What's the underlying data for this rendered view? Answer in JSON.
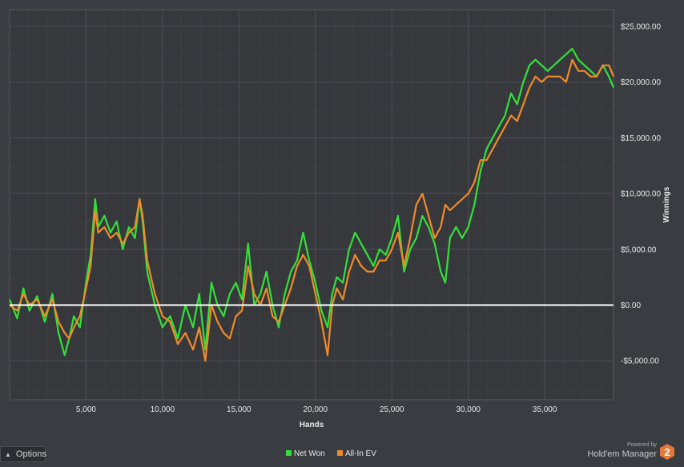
{
  "chart_data": {
    "type": "line",
    "xlabel": "Hands",
    "ylabel": "Winnings",
    "xlim": [
      0,
      39500
    ],
    "ylim": [
      -8500,
      26500
    ],
    "x_ticks": [
      5000,
      10000,
      15000,
      20000,
      25000,
      30000,
      35000
    ],
    "x_tick_labels": [
      "5,000",
      "10,000",
      "15,000",
      "20,000",
      "25,000",
      "30,000",
      "35,000"
    ],
    "y_ticks": [
      -5000,
      0,
      5000,
      10000,
      15000,
      20000,
      25000
    ],
    "y_tick_labels": [
      "-$5,000.00",
      "$0.00",
      "$5,000.00",
      "$10,000.00",
      "$15,000.00",
      "$20,000.00",
      "$25,000.00"
    ],
    "zero_line": true,
    "grid": true,
    "legend_position": "bottom-center",
    "series": [
      {
        "name": "Net Won",
        "color": "#33e03a",
        "x": [
          0,
          500,
          900,
          1300,
          1800,
          2300,
          2800,
          3200,
          3600,
          3900,
          4200,
          4600,
          5000,
          5300,
          5600,
          5800,
          6200,
          6600,
          7000,
          7400,
          7800,
          8200,
          8500,
          8700,
          9000,
          9500,
          10000,
          10500,
          11000,
          11500,
          12000,
          12400,
          12800,
          13200,
          13600,
          14000,
          14400,
          14800,
          15200,
          15600,
          16000,
          16400,
          16800,
          17200,
          17600,
          18000,
          18400,
          18800,
          19200,
          19600,
          20000,
          20400,
          20800,
          21100,
          21400,
          21800,
          22200,
          22600,
          23000,
          23400,
          23800,
          24200,
          24600,
          25000,
          25400,
          25800,
          26200,
          26600,
          27000,
          27400,
          27800,
          28200,
          28500,
          28800,
          29200,
          29600,
          30000,
          30400,
          30800,
          31200,
          31600,
          32000,
          32400,
          32800,
          33200,
          33600,
          34000,
          34400,
          34800,
          35200,
          35600,
          36000,
          36400,
          36800,
          37200,
          37600,
          38000,
          38400,
          38800,
          39200,
          39500
        ],
        "y": [
          500,
          -1200,
          1500,
          -500,
          800,
          -1500,
          1000,
          -2500,
          -4500,
          -3000,
          -1000,
          -2000,
          2000,
          4500,
          9500,
          7000,
          8000,
          6500,
          7500,
          5000,
          7000,
          6000,
          9500,
          7500,
          3000,
          0,
          -2000,
          -1000,
          -3000,
          0,
          -2000,
          1000,
          -4000,
          2000,
          0,
          -1000,
          1000,
          2000,
          500,
          5500,
          0,
          1000,
          3000,
          0,
          -2000,
          1000,
          3000,
          4000,
          6500,
          4000,
          2000,
          -500,
          -2000,
          1000,
          2500,
          2000,
          5000,
          6500,
          5500,
          4500,
          3500,
          5000,
          4500,
          6000,
          8000,
          3000,
          5000,
          6000,
          8000,
          7000,
          5500,
          3000,
          2000,
          6000,
          7000,
          6000,
          7000,
          9000,
          12000,
          14000,
          15000,
          16000,
          17000,
          19000,
          18000,
          20000,
          21500,
          22000,
          21500,
          21000,
          21500,
          22000,
          22500,
          23000,
          22000,
          21500,
          21000,
          20500,
          21500,
          20500,
          19500
        ]
      },
      {
        "name": "All-In EV",
        "color": "#f08a2a",
        "x": [
          0,
          500,
          900,
          1300,
          1800,
          2300,
          2800,
          3200,
          3600,
          3900,
          4200,
          4600,
          5000,
          5300,
          5600,
          5800,
          6200,
          6600,
          7000,
          7400,
          7800,
          8200,
          8500,
          8700,
          9000,
          9500,
          10000,
          10500,
          11000,
          11500,
          12000,
          12400,
          12800,
          13200,
          13600,
          14000,
          14400,
          14800,
          15200,
          15600,
          16000,
          16400,
          16800,
          17200,
          17600,
          18000,
          18400,
          18800,
          19200,
          19600,
          20000,
          20400,
          20800,
          21100,
          21400,
          21800,
          22200,
          22600,
          23000,
          23400,
          23800,
          24200,
          24600,
          25000,
          25400,
          25800,
          26200,
          26600,
          27000,
          27400,
          27800,
          28200,
          28500,
          28800,
          29200,
          29600,
          30000,
          30400,
          30800,
          31200,
          31600,
          32000,
          32400,
          32800,
          33200,
          33600,
          34000,
          34400,
          34800,
          35200,
          35600,
          36000,
          36400,
          36800,
          37200,
          37600,
          38000,
          38400,
          38800,
          39200,
          39500
        ],
        "y": [
          0,
          -500,
          1000,
          0,
          500,
          -1000,
          500,
          -1500,
          -2500,
          -3000,
          -2000,
          -1000,
          1500,
          3500,
          8500,
          6500,
          7000,
          6000,
          6500,
          5500,
          6500,
          7000,
          9500,
          8000,
          4000,
          1000,
          -1000,
          -1500,
          -3500,
          -2500,
          -4000,
          -2000,
          -5000,
          0,
          -1500,
          -2500,
          -3000,
          -1000,
          -500,
          3500,
          1000,
          0,
          1500,
          -1000,
          -1500,
          0,
          1500,
          3500,
          4500,
          3500,
          1000,
          -1500,
          -4500,
          0,
          1500,
          500,
          3000,
          4500,
          3500,
          3000,
          3000,
          4000,
          4000,
          5000,
          6500,
          3500,
          6000,
          9000,
          10000,
          8000,
          6000,
          7000,
          9000,
          8500,
          9000,
          9500,
          10000,
          11000,
          13000,
          13000,
          14000,
          15000,
          16000,
          17000,
          16500,
          18000,
          19500,
          20500,
          20000,
          20500,
          20500,
          20500,
          20000,
          22000,
          21000,
          21000,
          20500,
          20500,
          21500,
          21500,
          20500
        ]
      }
    ]
  },
  "ui": {
    "options_label": "Options",
    "powered_by": "Powered by",
    "product_name": "Hold'em Manager",
    "logo_digit": "2",
    "colors": {
      "background": "#393c40",
      "plot_background": "#36383c",
      "grid": "#4d5156",
      "zero_line": "#ffffff",
      "text": "#e8e8e8",
      "logo_accent": "#e2793a"
    }
  }
}
